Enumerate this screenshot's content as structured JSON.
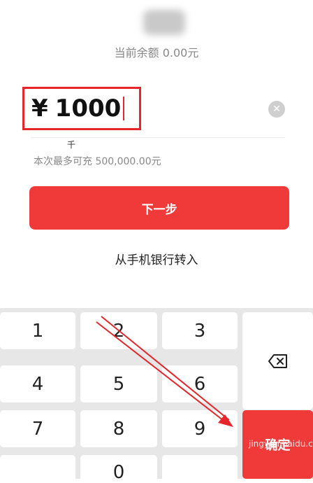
{
  "header": {
    "balance_label": "当前余额 0.00元"
  },
  "amount_input": {
    "currency_symbol": "¥",
    "value": "1000",
    "unit_hint": "千",
    "limit_text": "本次最多可充 500,000.00元"
  },
  "actions": {
    "next_label": "下一步",
    "bank_transfer_label": "从手机银行转入"
  },
  "keypad": {
    "keys": [
      "1",
      "2",
      "3",
      "4",
      "5",
      "6",
      "7",
      "8",
      "9",
      "0"
    ],
    "confirm_label": "确定"
  },
  "colors": {
    "accent": "#f03a3a",
    "annotation": "#e8252a"
  },
  "watermark": {
    "text": "jingyan.baidu.com"
  }
}
